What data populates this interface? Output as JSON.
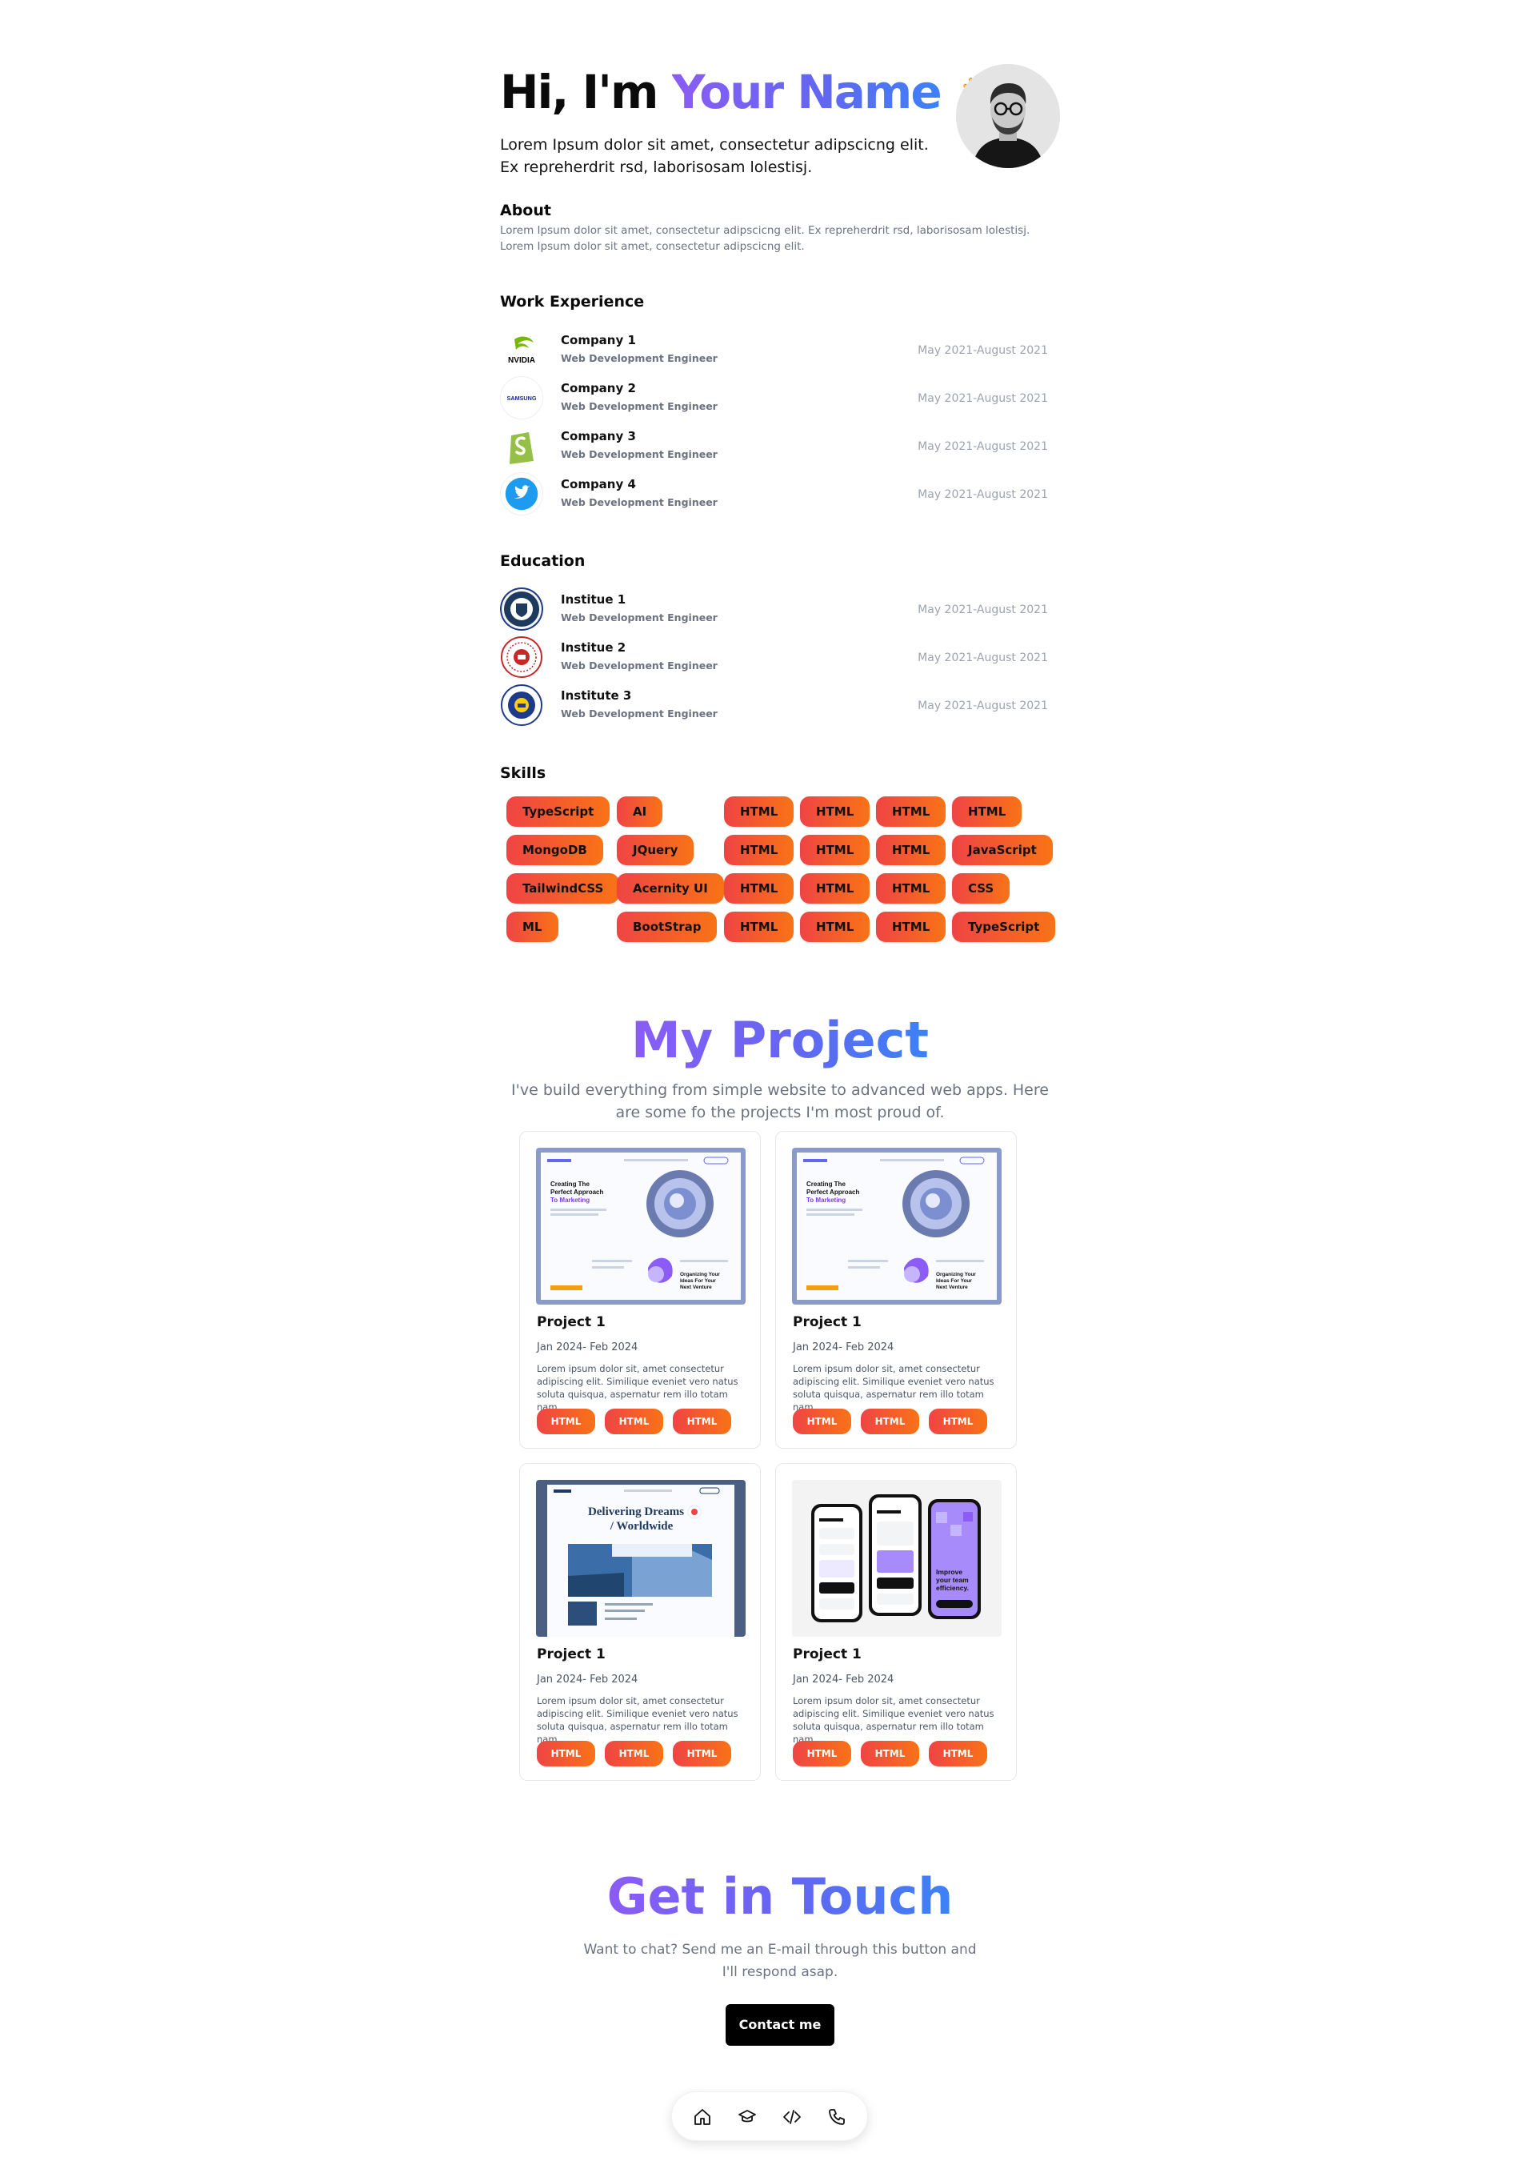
{
  "hero": {
    "greeting": "Hi, I'm ",
    "name": "Your Name",
    "wave": "👋",
    "line1": "Lorem Ipsum dolor sit amet, consectetur adipscicng elit.",
    "line2": "Ex repreherdrit rsd, laborisosam lolestisj."
  },
  "about": {
    "title": "About",
    "text": "Lorem Ipsum dolor sit amet, consectetur adipscicng elit. Ex repreherdrit rsd, laborisosam lolestisj. Lorem Ipsum dolor sit amet, consectetur adipscicng elit."
  },
  "work": {
    "title": "Work Experience",
    "items": [
      {
        "name": "Company 1",
        "role": "Web Development Engineer",
        "date": "May 2021-August 2021",
        "logo": "nvidia-logo"
      },
      {
        "name": "Company 2",
        "role": "Web Development Engineer",
        "date": "May 2021-August 2021",
        "logo": "samsung-logo"
      },
      {
        "name": "Company 3",
        "role": "Web Development Engineer",
        "date": "May 2021-August 2021",
        "logo": "shopify-logo"
      },
      {
        "name": "Company 4",
        "role": "Web Development Engineer",
        "date": "May 2021-August 2021",
        "logo": "twitter-logo"
      }
    ]
  },
  "education": {
    "title": "Education",
    "items": [
      {
        "name": "Institue 1",
        "role": "Web Development Engineer",
        "date": "May 2021-August 2021"
      },
      {
        "name": "Institue 2",
        "role": "Web Development Engineer",
        "date": "May 2021-August 2021"
      },
      {
        "name": "Institute 3",
        "role": "Web Development Engineer",
        "date": "May 2021-August 2021"
      }
    ]
  },
  "skills": {
    "title": "Skills",
    "col1": [
      "TypeScript",
      "MongoDB",
      "TailwindCSS",
      "ML"
    ],
    "col2": [
      "AI",
      "JQuery",
      "Acernity UI",
      "BootStrap"
    ],
    "col3": [
      "HTML",
      "HTML",
      "HTML",
      "HTML"
    ],
    "col4": [
      "HTML",
      "HTML",
      "HTML",
      "HTML"
    ],
    "col5": [
      "HTML",
      "HTML",
      "HTML",
      "HTML"
    ],
    "col6": [
      "HTML",
      "JavaScript",
      "CSS",
      "TypeScript"
    ]
  },
  "projects": {
    "title": "My Project",
    "subtitle": "I've build everything from simple website to advanced web apps. Here are some fo the projects I'm most proud of.",
    "cards": [
      {
        "title": "Project 1",
        "date": "Jan 2024- Feb 2024",
        "desc": "Lorem ipsum dolor sit, amet consectetur adipiscing elit. Similique eveniet vero natus soluta quisqua, aspernatur rem illo totam nam.",
        "tags": [
          "HTML",
          "HTML",
          "HTML"
        ],
        "shot": "marketing"
      },
      {
        "title": "Project 1",
        "date": "Jan 2024- Feb 2024",
        "desc": "Lorem ipsum dolor sit, amet consectetur adipiscing elit. Similique eveniet vero natus soluta quisqua, aspernatur rem illo totam nam.",
        "tags": [
          "HTML",
          "HTML",
          "HTML"
        ],
        "shot": "marketing"
      },
      {
        "title": "Project 1",
        "date": "Jan 2024- Feb 2024",
        "desc": "Lorem ipsum dolor sit, amet consectetur adipiscing elit. Similique eveniet vero natus soluta quisqua, aspernatur rem illo totam nam.",
        "tags": [
          "HTML",
          "HTML",
          "HTML"
        ],
        "shot": "logistics"
      },
      {
        "title": "Project 1",
        "date": "Jan 2024- Feb 2024",
        "desc": "Lorem ipsum dolor sit, amet consectetur adipiscing elit. Similique eveniet vero natus soluta quisqua, aspernatur rem illo totam nam.",
        "tags": [
          "HTML",
          "HTML",
          "HTML"
        ],
        "shot": "mobile"
      }
    ],
    "shot_text": {
      "marketing_headline": "Creating The Perfect Approach To Marketing",
      "marketing_side": "Organizing Your Ideas For Your Next Venture",
      "logistics_headline_1": "Delivering Dreams",
      "logistics_headline_2": "/ Worldwide",
      "mobile_text": "Improve your team efficiency."
    }
  },
  "contact": {
    "title": "Get in Touch",
    "text": "Want to chat? Send me an E-mail through this button and I'll respond asap.",
    "button": "Contact me"
  },
  "dock": {
    "icons": [
      "home-icon",
      "graduation-cap-icon",
      "code-icon",
      "phone-icon"
    ]
  },
  "colors": {
    "accent_gradient": [
      "#8b5cf6",
      "#3b82f6"
    ],
    "pill_gradient": [
      "#ef4444",
      "#f97316"
    ]
  }
}
